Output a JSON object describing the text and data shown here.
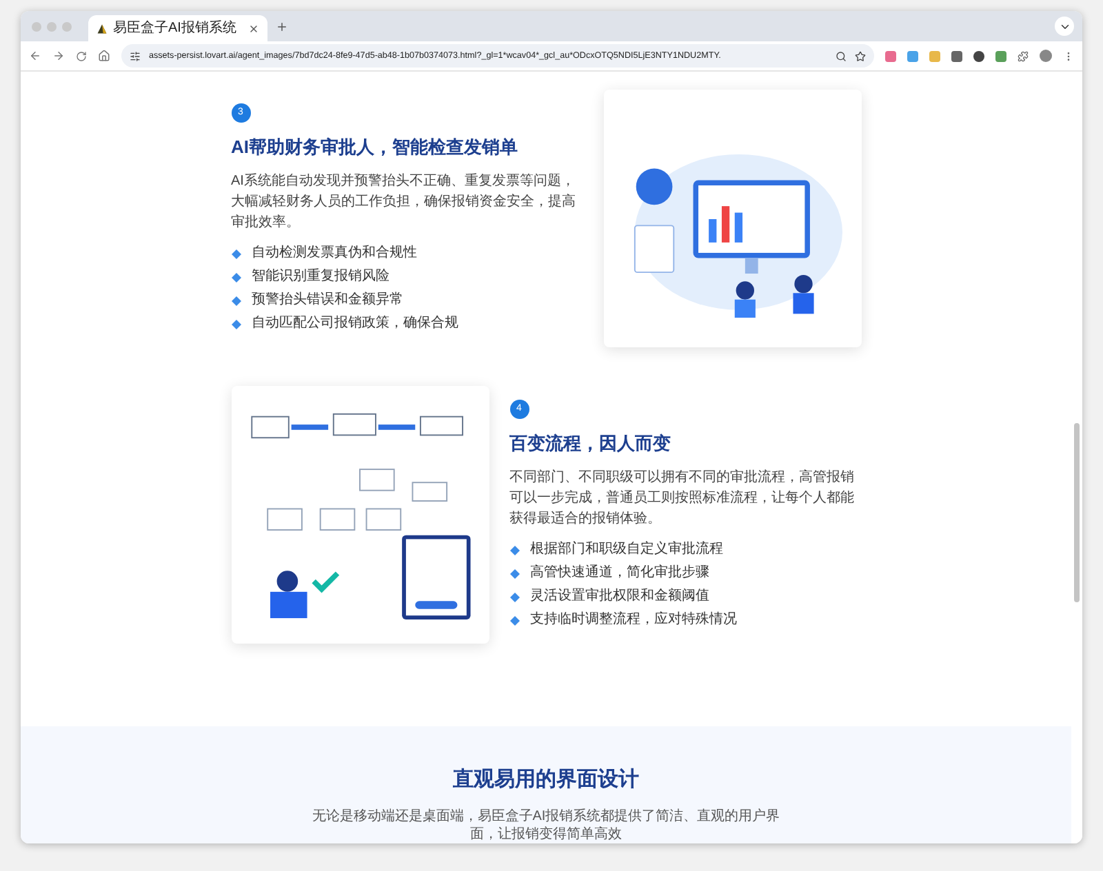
{
  "browser": {
    "tabs": [
      {
        "title": "易臣盒子AI报销系统",
        "selected": true
      }
    ],
    "url": "assets-persist.lovart.ai/agent_images/7bd7dc24-8fe9-47d5-ab48-1b07b0374073.html?_gl=1*wcav04*_gcl_au*ODcxOTQ5NDI5LjE3NTY1NDU2MTY."
  },
  "features": [
    {
      "number": "3",
      "title": "AI帮助财务审批人，智能检查发销单",
      "description": "AI系统能自动发现并预警抬头不正确、重复发票等问题，大幅减轻财务人员的工作负担，确保报销资金安全，提高审批效率。",
      "points": [
        "自动检测发票真伪和合规性",
        "智能识别重复报销风险",
        "预警抬头错误和金额异常",
        "自动匹配公司报销政策，确保合规"
      ],
      "kind": "monitor"
    },
    {
      "number": "4",
      "title": "百变流程，因人而变",
      "description": "不同部门、不同职级可以拥有不同的审批流程，高管报销可以一步完成，普通员工则按照标准流程，让每个人都能获得最适合的报销体验。",
      "points": [
        "根据部门和职级自定义审批流程",
        "高管快速通道，简化审批步骤",
        "灵活设置审批权限和金额阈值",
        "支持临时调整流程，应对特殊情况"
      ],
      "kind": "flowchart"
    }
  ],
  "next_section": {
    "title": "直观易用的界面设计",
    "description": "无论是移动端还是桌面端，易臣盒子AI报销系统都提供了简洁、直观的用户界面，让报销变得简单高效"
  }
}
